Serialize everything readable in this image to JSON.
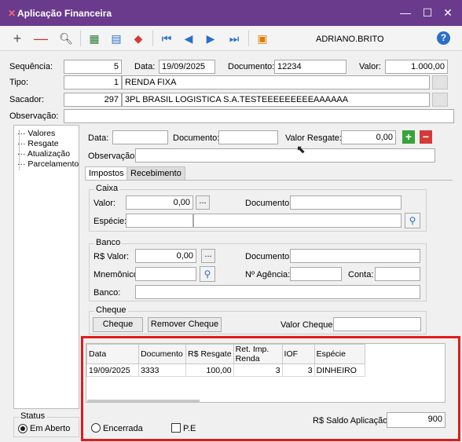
{
  "window": {
    "title": "Aplicação Financeira",
    "minimize": "—",
    "maximize": "☐",
    "close": "✕"
  },
  "toolbar": {
    "user": "ADRIANO.BRITO",
    "help": "?"
  },
  "header": {
    "sequencia_label": "Sequência:",
    "sequencia_value": "5",
    "data_label": "Data:",
    "data_value": "19/09/2025",
    "documento_label": "Documento:",
    "documento_value": "12234",
    "valor_label": "Valor:",
    "valor_value": "1.000,00",
    "tipo_label": "Tipo:",
    "tipo_code": "1",
    "tipo_name": "RENDA FIXA",
    "sacador_label": "Sacador:",
    "sacador_code": "297",
    "sacador_name": "3PL BRASIL LOGISTICA S.A.TESTEEEEEEEEEAAAAAA",
    "observacao_label": "Observação:",
    "observacao_value": ""
  },
  "tree": {
    "items": [
      "Valores",
      "Resgate",
      "Atualização",
      "Parcelamento"
    ]
  },
  "resgate": {
    "data_label": "Data:",
    "data_value": "",
    "documento_label": "Documento:",
    "documento_value": "",
    "valor_label": "Valor Resgate:",
    "valor_value": "0,00",
    "observacao_label": "Observação:",
    "observacao_value": ""
  },
  "tabs": [
    "Impostos",
    "Recebimento"
  ],
  "caixa": {
    "title": "Caixa",
    "valor_label": "Valor:",
    "valor_value": "0,00",
    "documento_label": "Documento:",
    "especie_label": "Espécie:"
  },
  "banco": {
    "title": "Banco",
    "valor_label": "R$ Valor:",
    "valor_value": "0,00",
    "documento_label": "Documento:",
    "mnemonico_label": "Mnemônico:",
    "agencia_label": "Nº Agência:",
    "conta_label": "Conta:",
    "banco_label": "Banco:"
  },
  "cheque": {
    "title": "Cheque",
    "cheque_button": "Cheque",
    "remover_button": "Remover Cheque",
    "valor_label": "Valor Cheque:"
  },
  "grid": {
    "columns": [
      "Data",
      "Documento",
      "R$ Resgate",
      "Ret. Imp. Renda",
      "IOF",
      "Espécie"
    ],
    "rows": [
      [
        "19/09/2025",
        "3333",
        "100,00",
        "3",
        "3",
        "DINHEIRO"
      ]
    ]
  },
  "status": {
    "title": "Status",
    "em_aberto": "Em Aberto",
    "encerrada": "Encerrada",
    "pe": "P.E",
    "saldo_label": "R$ Saldo Aplicação:",
    "saldo_value": "900"
  }
}
